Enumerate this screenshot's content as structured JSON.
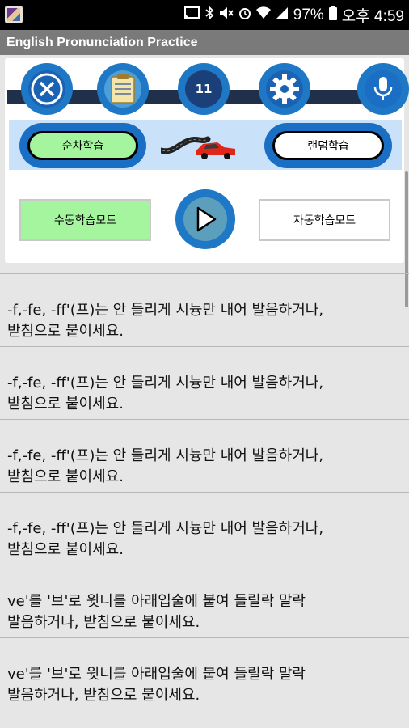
{
  "status_bar": {
    "battery": "97%",
    "clock": "오후 4:59",
    "icons": [
      "cast-icon",
      "bluetooth-icon",
      "mute-icon",
      "alarm-icon",
      "wifi-icon",
      "signal-icon",
      "battery-icon"
    ]
  },
  "app": {
    "title": "English Pronunciation Practice"
  },
  "toolbar": {
    "counter": "11",
    "icons": [
      "close-icon",
      "clipboard-icon",
      "counter-badge",
      "gear-icon",
      "microphone-icon"
    ]
  },
  "modes": {
    "sequential": "순차학습",
    "random": "랜덤학습",
    "manual": "수동학습모드",
    "auto": "자동학습모드"
  },
  "colors": {
    "accent_blue": "#1e78c6",
    "title_bar": "#7a7a7a",
    "active_green": "#a5f59e",
    "strip": "#c9e2f9"
  },
  "items": [
    {
      "line1": "-f,-fe, -ff'(프)는 안 들리게 시늉만 내어 발음하거나,",
      "line2": "받침으로 붙이세요."
    },
    {
      "line1": "-f,-fe, -ff'(프)는 안 들리게 시늉만 내어 발음하거나,",
      "line2": "받침으로 붙이세요."
    },
    {
      "line1": "-f,-fe, -ff'(프)는 안 들리게 시늉만 내어 발음하거나,",
      "line2": "받침으로 붙이세요."
    },
    {
      "line1": "-f,-fe, -ff'(프)는 안 들리게 시늉만 내어 발음하거나,",
      "line2": "받침으로 붙이세요."
    },
    {
      "line1": "ve'를 '브'로 윗니를 아래입술에 붙여 들릴락 말락",
      "line2": "발음하거나, 받침으로 붙이세요."
    },
    {
      "line1": "ve'를 '브'로 윗니를 아래입술에 붙여 들릴락 말락",
      "line2": "발음하거나, 받침으로 붙이세요."
    }
  ]
}
